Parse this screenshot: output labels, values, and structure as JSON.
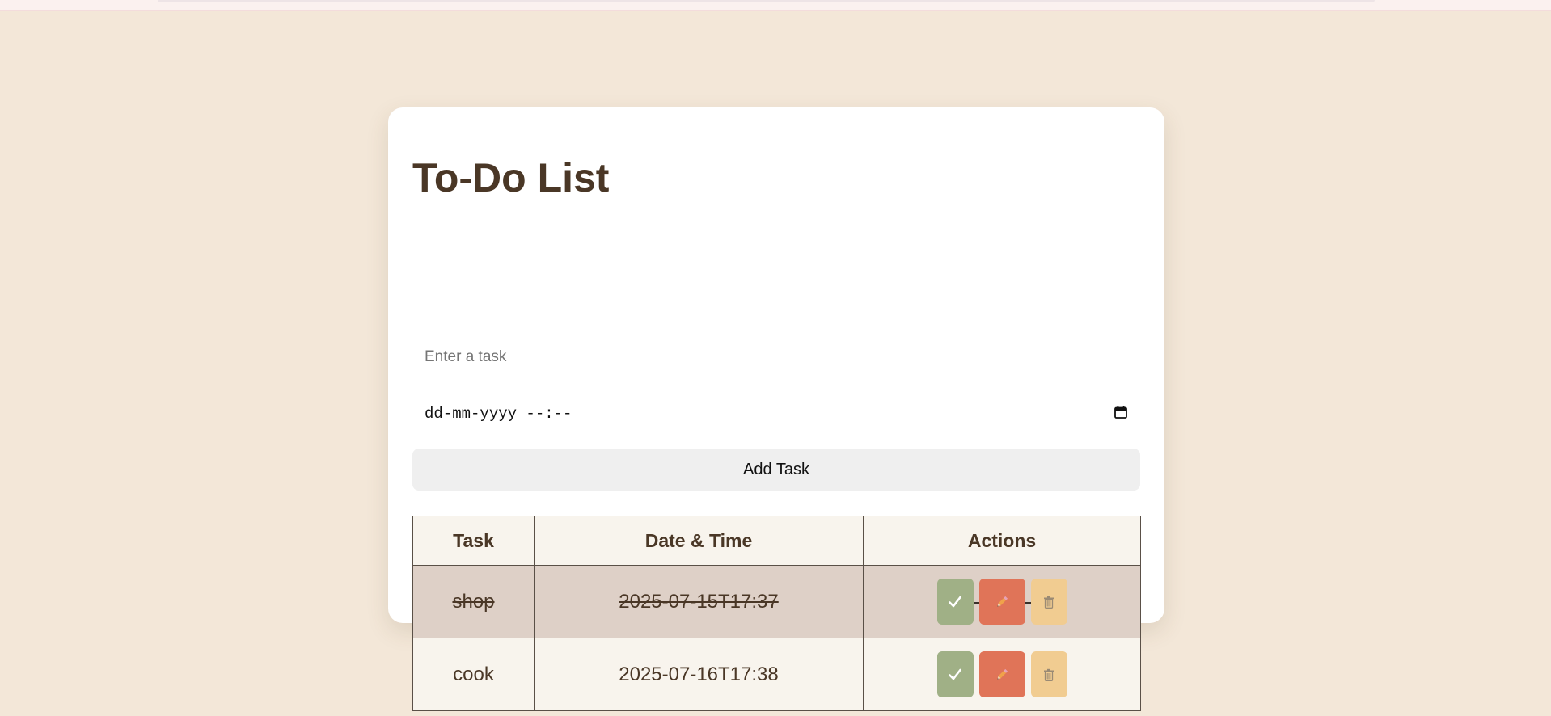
{
  "app": {
    "title": "To-Do List"
  },
  "form": {
    "task_placeholder": "Enter a task",
    "datetime_placeholder": "dd-mm-yyyy --:--",
    "add_label": "Add Task"
  },
  "table": {
    "headers": [
      "Task",
      "Date & Time",
      "Actions"
    ],
    "rows": [
      {
        "task": "shop",
        "datetime": "2025-07-15T17:37",
        "completed": true
      },
      {
        "task": "cook",
        "datetime": "2025-07-16T17:38",
        "completed": false
      }
    ]
  },
  "icons": {
    "complete": "check-icon",
    "edit": "pencil-icon",
    "delete": "trash-icon",
    "calendar": "calendar-icon"
  },
  "colors": {
    "background": "#f3e7d8",
    "title": "#4a3726",
    "complete_button": "#a0b086",
    "edit_button": "#e07458",
    "delete_button": "#f1cc91",
    "completed_row": "#ded0c7"
  }
}
